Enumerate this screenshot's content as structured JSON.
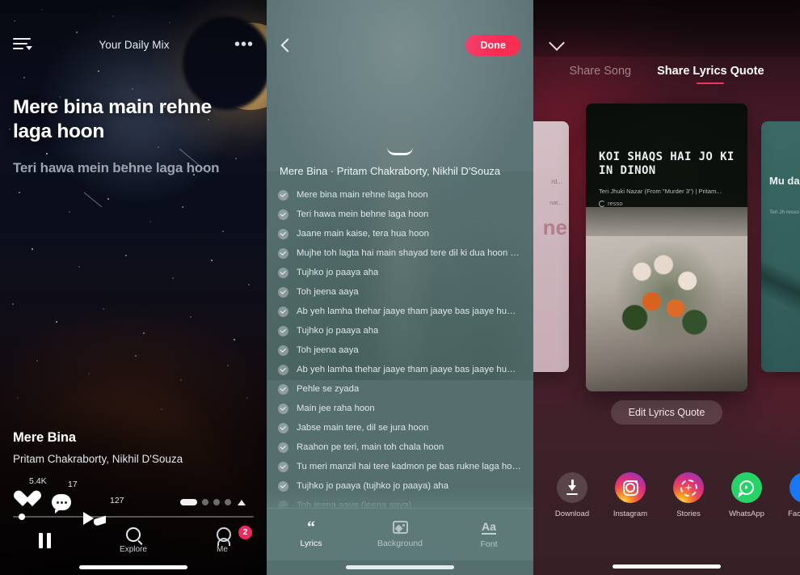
{
  "colors": {
    "accent_pink": "#f2355c",
    "done_button": "#f72d57",
    "badge_pink": "#ec2c61",
    "lyrics_panel_tint": "#5d7a78",
    "share_panel_bg": "#3a2128",
    "instagram": "#d92e7f",
    "whatsapp": "#25d366",
    "facebook": "#1877f2"
  },
  "now_playing": {
    "icons": {
      "queue": "queue-list-icon",
      "more": "more-options-icon",
      "like": "heart-icon",
      "comment": "comment-bubble-icon",
      "share": "share-arrow-icon",
      "pause": "pause-icon",
      "explore": "search-icon",
      "me": "person-icon"
    },
    "header_title": "Your Daily Mix",
    "more_label": "•••",
    "lyric_active": "Mere bina main rehne laga hoon",
    "lyric_next": "Teri hawa mein behne laga hoon",
    "song_title": "Mere Bina",
    "artists": "Pritam Chakraborty, Nikhil D'Souza",
    "like_count": "5.4K",
    "comment_count": "17",
    "share_count": "127",
    "tabs": [
      {
        "label": "",
        "name": "pause"
      },
      {
        "label": "Explore",
        "name": "explore"
      },
      {
        "label": "Me",
        "name": "me"
      }
    ],
    "me_badge": "2"
  },
  "lyrics_picker": {
    "back_label": "‹",
    "done_label": "Done",
    "song_header": "Mere Bina · Pritam Chakraborty, Nikhil D'Souza",
    "lines": [
      "Mere bina main rehne laga hoon",
      "Teri hawa mein behne laga hoon",
      "Jaane main kaise, tera hua hoon",
      "Mujhe toh lagta hai main shayad tere dil ki dua hoon haan",
      "Tujhko jo paaya aha",
      "Toh jeena aaya",
      "Ab yeh lamha thehar jaaye tham jaaye bas jaaye hum dono k...",
      "Tujhko jo paaya aha",
      "Toh jeena aaya",
      "Ab yeh lamha thehar jaaye tham jaaye bas jaaye hum dono k...",
      "Pehle se zyada",
      "Main jee raha hoon",
      "Jabse main tere, dil se jura hoon",
      "Raahon pe teri, main toh chala hoon",
      "Tu meri manzil hai tere kadmon pe bas rukne laga hoon haan",
      "Tujhko jo paaya (tujhko jo paaya) aha",
      "Toh jeena aaya (jeena aaya)"
    ],
    "toolbar": [
      {
        "label": "Lyrics",
        "icon": "quote-icon",
        "active": true
      },
      {
        "label": "Background",
        "icon": "image-icon",
        "active": false
      },
      {
        "label": "Font",
        "icon": "font-size-icon",
        "active": false
      }
    ]
  },
  "share": {
    "close_label": "chevron-down-icon",
    "tabs": [
      {
        "label": "Share Song",
        "active": false
      },
      {
        "label": "Share Lyrics Quote",
        "active": true
      }
    ],
    "card": {
      "title": "KOI SHAQS HAI JO KI IN DINON",
      "subtitle": "Teri Jhuki Nazar (From \"Murder 3\") | Pritam...",
      "brand": "resso"
    },
    "card_left_preview": {
      "line1": "rd...",
      "line2": "nat...",
      "big": "ne"
    },
    "card_right_preview": {
      "title": "Mu\ndas",
      "sub": "Teri Jh\nresso"
    },
    "edit_button": "Edit Lyrics Quote",
    "targets": [
      {
        "label": "Download",
        "icon": "download-icon"
      },
      {
        "label": "Instagram",
        "icon": "instagram-icon"
      },
      {
        "label": "Stories",
        "icon": "instagram-stories-icon"
      },
      {
        "label": "WhatsApp",
        "icon": "whatsapp-icon"
      },
      {
        "label": "Facebook",
        "icon": "facebook-icon"
      }
    ]
  }
}
